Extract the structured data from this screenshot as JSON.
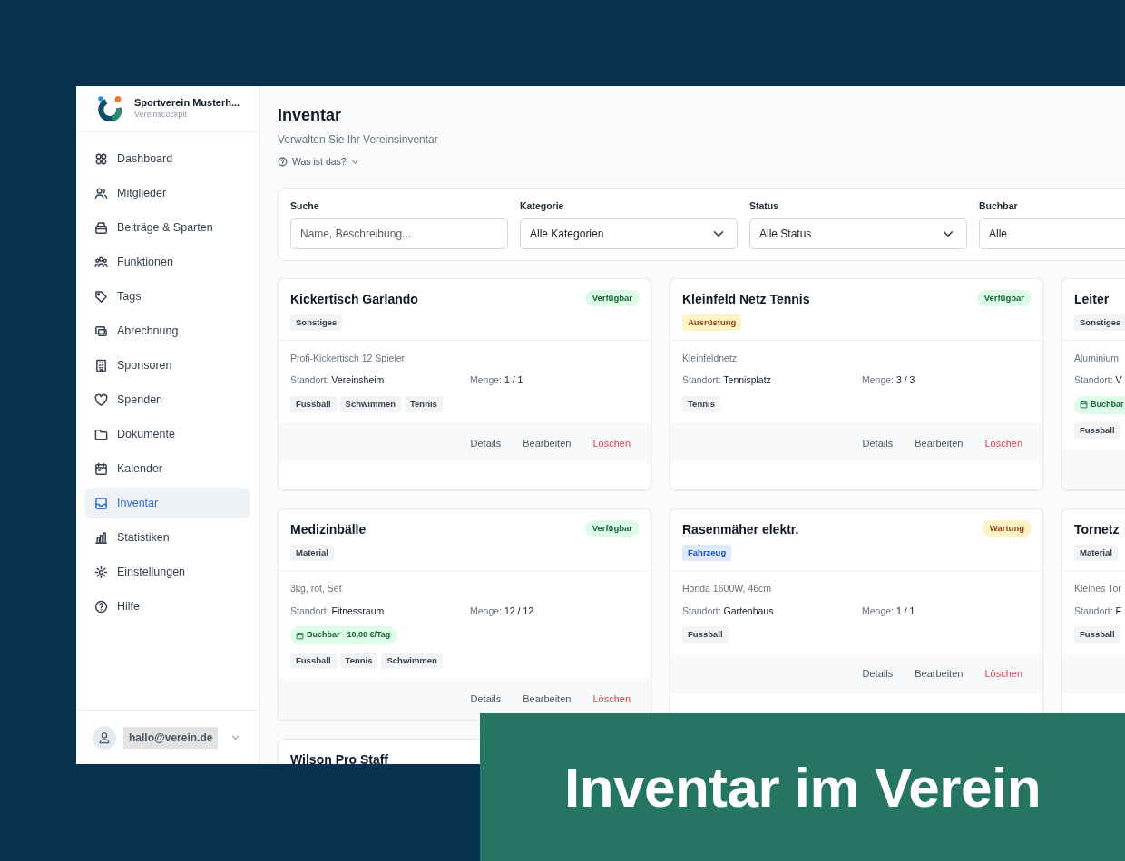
{
  "sidebar": {
    "club_name": "Sportverein Musterh...",
    "subtitle": "Vereinscockpit",
    "items": [
      {
        "label": "Dashboard",
        "selected": false
      },
      {
        "label": "Mitglieder",
        "selected": false
      },
      {
        "label": "Beiträge & Sparten",
        "selected": false
      },
      {
        "label": "Funktionen",
        "selected": false
      },
      {
        "label": "Tags",
        "selected": false
      },
      {
        "label": "Abrechnung",
        "selected": false
      },
      {
        "label": "Sponsoren",
        "selected": false
      },
      {
        "label": "Spenden",
        "selected": false
      },
      {
        "label": "Dokumente",
        "selected": false
      },
      {
        "label": "Kalender",
        "selected": false
      },
      {
        "label": "Inventar",
        "selected": true
      },
      {
        "label": "Statistiken",
        "selected": false
      },
      {
        "label": "Einstellungen",
        "selected": false
      },
      {
        "label": "Hilfe",
        "selected": false
      }
    ],
    "user": {
      "email": "hallo@verein.de"
    }
  },
  "page": {
    "title": "Inventar",
    "subtitle": "Verwalten Sie Ihr Vereinsinventar",
    "help": "Was ist das?"
  },
  "filters": [
    {
      "label": "Suche",
      "kind": "text",
      "placeholder": "Name, Beschreibung..."
    },
    {
      "label": "Kategorie",
      "kind": "select",
      "value": "Alle Kategorien"
    },
    {
      "label": "Status",
      "kind": "select",
      "value": "Alle Status"
    },
    {
      "label": "Buchbar",
      "kind": "select",
      "value": "Alle"
    }
  ],
  "items": [
    {
      "title": "Kickertisch Garlando",
      "category": {
        "label": "Sonstiges",
        "color": "#f1f3f5"
      },
      "status": {
        "label": "Verfügbar",
        "kind": "available"
      },
      "description": "Profi-Kickertisch 12 Spieler",
      "location_label": "Standort:",
      "location": "Vereinsheim",
      "quantity_label": "Menge:",
      "quantity": "1 / 1",
      "tags": [
        "Fussball",
        "Schwimmen",
        "Tennis"
      ],
      "actions": [
        "Details",
        "Bearbeiten",
        "Löschen"
      ]
    },
    {
      "title": "Kleinfeld Netz Tennis",
      "category": {
        "label": "Ausrüstung",
        "color": "#fef3c7"
      },
      "status": {
        "label": "Verfügbar",
        "kind": "available"
      },
      "description": "Kleinfeldnetz",
      "location_label": "Standort:",
      "location": "Tennisplatz",
      "quantity_label": "Menge:",
      "quantity": "3 / 3",
      "tags": [
        "Tennis"
      ],
      "actions": [
        "Details",
        "Bearbeiten",
        "Löschen"
      ]
    },
    {
      "title": "Leiter",
      "category": {
        "label": "Sonstiges",
        "color": "#f1f3f5"
      },
      "description": "Aluminium",
      "location_label": "Standort:",
      "location": "V",
      "booking": "Buchbar",
      "tags": [
        "Fussball"
      ],
      "footer": true
    },
    {
      "title": "Medizinbälle",
      "category": {
        "label": "Material",
        "color": "#f1f3f5"
      },
      "status": {
        "label": "Verfügbar",
        "kind": "available"
      },
      "description": "3kg, rot, Set",
      "location_label": "Standort:",
      "location": "Fitnessraum",
      "quantity_label": "Menge:",
      "quantity": "12 / 12",
      "booking": "Buchbar · 10,00 €/Tag",
      "tags": [
        "Fussball",
        "Tennis",
        "Schwimmen"
      ],
      "actions": [
        "Details",
        "Bearbeiten",
        "Löschen"
      ]
    },
    {
      "title": "Rasenmäher elektr.",
      "category": {
        "label": "Fahrzeug",
        "color": "#dbeafe"
      },
      "status": {
        "label": "Wartung",
        "kind": "maintenance"
      },
      "description": "Honda 1600W, 46cm",
      "location_label": "Standort:",
      "location": "Gartenhaus",
      "quantity_label": "Menge:",
      "quantity": "1 / 1",
      "tags": [
        "Fussball"
      ],
      "actions": [
        "Details",
        "Bearbeiten",
        "Löschen"
      ]
    },
    {
      "title": "Tornetz",
      "category": {
        "label": "Material",
        "color": "#f1f3f5"
      },
      "description": "Kleines Tor",
      "location_label": "Standort:",
      "location": "F",
      "tags": [
        "Fussball"
      ],
      "footer": true
    },
    {
      "title": "Wilson Pro Staff"
    }
  ],
  "banner": {
    "text": "Inventar im Verein"
  }
}
